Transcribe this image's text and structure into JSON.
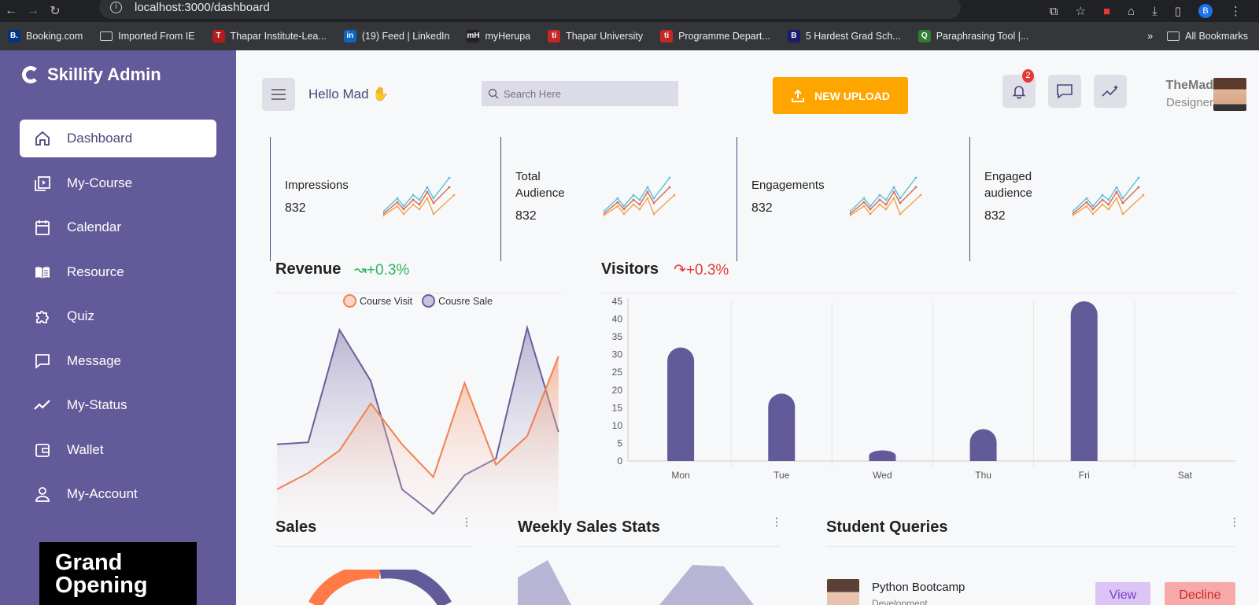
{
  "browser": {
    "url": "localhost:3000/dashboard",
    "profile_initial": "B",
    "bookmarks": [
      {
        "label": "Booking.com",
        "icon": "B.",
        "color": "#003580"
      },
      {
        "label": "Imported From IE",
        "icon": "folder",
        "color": "#35363a"
      },
      {
        "label": "Thapar Institute-Lea...",
        "icon": "T",
        "color": "#b71c1c"
      },
      {
        "label": "(19) Feed | LinkedIn",
        "icon": "in",
        "color": "#0a66c2"
      },
      {
        "label": "myHerupa",
        "icon": "mH",
        "color": "#222"
      },
      {
        "label": "Thapar University",
        "icon": "ti",
        "color": "#c62828"
      },
      {
        "label": "Programme Depart...",
        "icon": "ti",
        "color": "#c62828"
      },
      {
        "label": "5 Hardest Grad Sch...",
        "icon": "B",
        "color": "#1a1a6e"
      },
      {
        "label": "Paraphrasing Tool |...",
        "icon": "Q",
        "color": "#2e7d32"
      }
    ],
    "overflow": "»",
    "all_bookmarks": "All Bookmarks"
  },
  "sidebar": {
    "brand": "Skillify Admin",
    "items": [
      {
        "label": "Dashboard",
        "icon": "home-icon",
        "active": true
      },
      {
        "label": "My-Course",
        "icon": "video-library-icon",
        "active": false
      },
      {
        "label": "Calendar",
        "icon": "calendar-icon",
        "active": false
      },
      {
        "label": "Resource",
        "icon": "book-icon",
        "active": false
      },
      {
        "label": "Quiz",
        "icon": "puzzle-icon",
        "active": false
      },
      {
        "label": "Message",
        "icon": "message-icon",
        "active": false
      },
      {
        "label": "My-Status",
        "icon": "trend-icon",
        "active": false
      },
      {
        "label": "Wallet",
        "icon": "wallet-icon",
        "active": false
      },
      {
        "label": "My-Account",
        "icon": "user-icon",
        "active": false
      }
    ],
    "promo": "Grand Opening"
  },
  "header": {
    "greeting": "Hello Mad ✋",
    "search_placeholder": "Search Here",
    "upload_label": "NEW UPLOAD",
    "notification_count": "2",
    "user_name": "TheMad",
    "user_role": "Designer"
  },
  "stats": [
    {
      "label": "Impressions",
      "value": "832"
    },
    {
      "label": "Total Audience",
      "value": "832"
    },
    {
      "label": "Engagements",
      "value": "832"
    },
    {
      "label": "Engaged audience",
      "value": "832"
    }
  ],
  "revenue": {
    "title": "Revenue",
    "delta": "+0.3%",
    "delta_color": "#2db35d"
  },
  "visitors": {
    "title": "Visitors",
    "delta": "+0.3%",
    "delta_color": "#e53935"
  },
  "bottom": {
    "sales_title": "Sales",
    "weekly_title": "Weekly Sales Stats",
    "queries_title": "Student Queries",
    "query": {
      "title": "Python Bootcamp",
      "subtitle": "Development",
      "view_label": "View",
      "decline_label": "Decline"
    }
  },
  "colors": {
    "sidebar": "#635b99",
    "accent": "#ffa500",
    "bar": "#635b99",
    "area_orange": "#f28b5c"
  },
  "chart_data": [
    {
      "type": "area",
      "legend": [
        "Course Visit",
        "Cousre Sale"
      ],
      "series": [
        {
          "name": "Course Visit",
          "color": "#f0814f",
          "values": [
            20,
            28,
            39,
            62,
            42,
            26,
            72,
            32,
            46,
            85
          ]
        },
        {
          "name": "Cousre Sale",
          "color": "#6a5f9a",
          "values": [
            42,
            43,
            98,
            73,
            20,
            8,
            27,
            35,
            99,
            48
          ]
        }
      ],
      "ylim": [
        0,
        100
      ]
    },
    {
      "type": "bar",
      "categories": [
        "Mon",
        "Tue",
        "Wed",
        "Thu",
        "Fri",
        "Sat"
      ],
      "values": [
        32,
        19,
        3,
        9,
        45,
        0
      ],
      "ylim": [
        0,
        45
      ],
      "yticks": [
        0,
        5,
        10,
        15,
        20,
        25,
        30,
        35,
        40,
        45
      ],
      "grid": true
    }
  ]
}
